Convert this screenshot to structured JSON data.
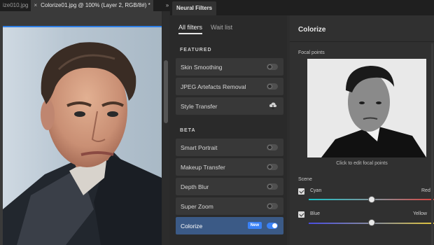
{
  "documents": {
    "tabs": [
      {
        "label": "ize010.jpg",
        "active": false
      },
      {
        "label": "Colorize01.jpg @ 100% (Layer 2, RGB/8#) *",
        "active": true
      }
    ],
    "close_glyph": "×",
    "panel_toggle_glyph": "»"
  },
  "neural_filters": {
    "panel_title": "Neural Filters",
    "tabs": [
      {
        "label": "All filters",
        "active": true
      },
      {
        "label": "Wait list",
        "active": false
      }
    ],
    "sections": {
      "featured": "FEATURED",
      "beta": "BETA"
    },
    "featured_filters": [
      {
        "label": "Skin Smoothing",
        "control": "toggle",
        "on": false
      },
      {
        "label": "JPEG Artefacts Removal",
        "control": "toggle",
        "on": false
      },
      {
        "label": "Style Transfer",
        "control": "cloud-download-icon"
      }
    ],
    "beta_filters": [
      {
        "label": "Smart Portrait",
        "control": "toggle",
        "on": false
      },
      {
        "label": "Makeup Transfer",
        "control": "toggle",
        "on": false
      },
      {
        "label": "Depth Blur",
        "control": "toggle",
        "on": false
      },
      {
        "label": "Super Zoom",
        "control": "toggle",
        "on": false
      },
      {
        "label": "Colorize",
        "control": "toggle",
        "on": true,
        "badge": "New",
        "selected": true
      }
    ]
  },
  "colorize": {
    "title": "Colorize",
    "focal_points_label": "Focal points",
    "focal_caption": "Click to edit focal points",
    "scene_label": "Scene",
    "sliders": [
      {
        "left_label": "Cyan",
        "right_label": "Red",
        "value": 0.5,
        "checked": true
      },
      {
        "left_label": "Blue",
        "right_label": "Yellow",
        "value": 0.5,
        "checked": true
      }
    ]
  },
  "colors": {
    "accent": "#3a82f7",
    "selected_row": "#3b5a86",
    "panel_bg": "#2d2d2d"
  }
}
